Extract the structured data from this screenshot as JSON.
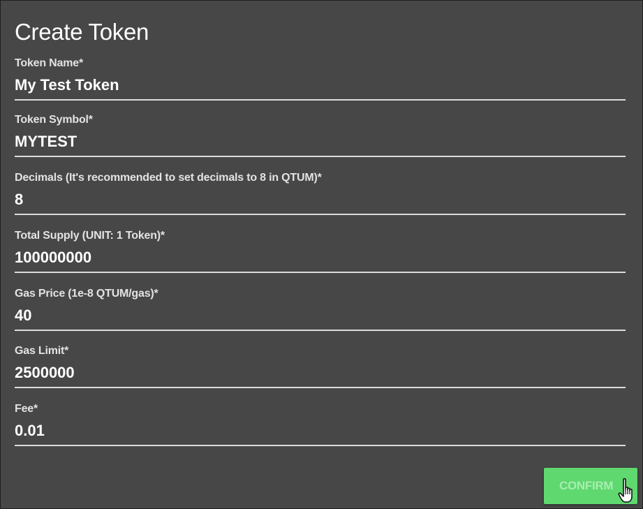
{
  "dialog": {
    "title": "Create Token"
  },
  "fields": [
    {
      "label": "Token Name*",
      "value": "My Test Token"
    },
    {
      "label": "Token Symbol*",
      "value": "MYTEST"
    },
    {
      "label": "Decimals (It's recommended to set decimals to 8 in QTUM)*",
      "value": "8"
    },
    {
      "label": "Total Supply (UNIT: 1 Token)*",
      "value": "100000000"
    },
    {
      "label": "Gas Price (1e-8 QTUM/gas)*",
      "value": "40"
    },
    {
      "label": "Gas Limit*",
      "value": "2500000"
    },
    {
      "label": "Fee*",
      "value": "0.01"
    }
  ],
  "actions": {
    "confirm_label": "CONFIRM"
  },
  "icons": {
    "cursor": "hand-pointer-icon"
  },
  "colors": {
    "background": "#474747",
    "text": "#ffffff",
    "underline": "#dcdcdc",
    "confirm_button": "#5fd86f",
    "confirm_text": "#a6eeb0"
  }
}
